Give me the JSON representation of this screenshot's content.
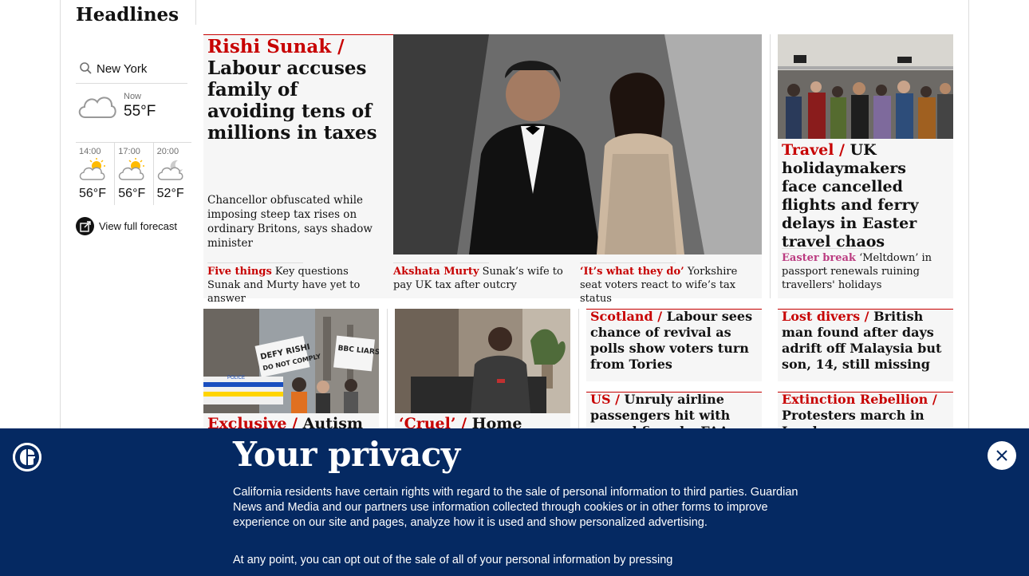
{
  "section": {
    "title": "Headlines"
  },
  "weather": {
    "location": "New York",
    "now_label": "Now",
    "now_temp": "55°F",
    "forecast": [
      {
        "time": "14:00",
        "temp": "56°F"
      },
      {
        "time": "17:00",
        "temp": "56°F"
      },
      {
        "time": "20:00",
        "temp": "52°F"
      }
    ],
    "view_full_label": "View full forecast"
  },
  "main_story": {
    "kicker": "Rishi Sunak /",
    "headline": "Labour accuses family of avoiding tens of millions in taxes",
    "standfirst": "Chancellor obfuscated while imposing steep tax rises on ordinary Britons, says shadow minister",
    "sublinks": [
      {
        "kicker": "Five things",
        "text": "Key questions Sunak and Murty have yet to answer"
      },
      {
        "kicker": "Akshata Murty",
        "text": "Sunak’s wife to pay UK tax after outcry"
      },
      {
        "kicker": "‘It’s what they do’",
        "text": "Yorkshire seat voters react to wife’s tax status"
      }
    ]
  },
  "travel_story": {
    "kicker": "Travel /",
    "headline": "UK holidaymakers face cancelled flights and ferry delays in Easter travel chaos",
    "sublink_kicker": "Easter break",
    "sublink_text": "‘Meltdown’ in passport renewals ruining travellers' holidays"
  },
  "row2": [
    {
      "kicker": "Exclusive /",
      "headline": "Autism"
    },
    {
      "kicker": "‘Cruel’ /",
      "headline": "Home Office"
    },
    {
      "kicker": "Scotland /",
      "headline": "Labour sees chance of revival as polls show voters turn from Tories"
    },
    {
      "kicker": "Lost divers /",
      "headline": "British man found after days adrift off Malaysia but son, 14, still missing"
    },
    {
      "kicker": "US /",
      "headline": "Unruly airline passengers hit with record fines by FAA"
    },
    {
      "kicker": "Extinction Rebellion /",
      "headline": "Protesters march in London"
    }
  ],
  "protest_signs": [
    "DEFY RISHI",
    "DO NOT COMPLY",
    "BBC LIARS",
    "POLICE"
  ],
  "privacy": {
    "title": "Your privacy",
    "body": "California residents have certain rights with regard to the sale of personal information to third parties. Guardian News and Media and our partners use information collected through cookies or in other forms to improve experience on our site and pages, analyze how it is used and show personalized advertising.",
    "body2": "At any point, you can opt out of the sale of all of your personal information by pressing"
  },
  "colors": {
    "news_red": "#c70000",
    "lifestyle_pink": "#bb3b80",
    "brand_blue": "#052962"
  }
}
